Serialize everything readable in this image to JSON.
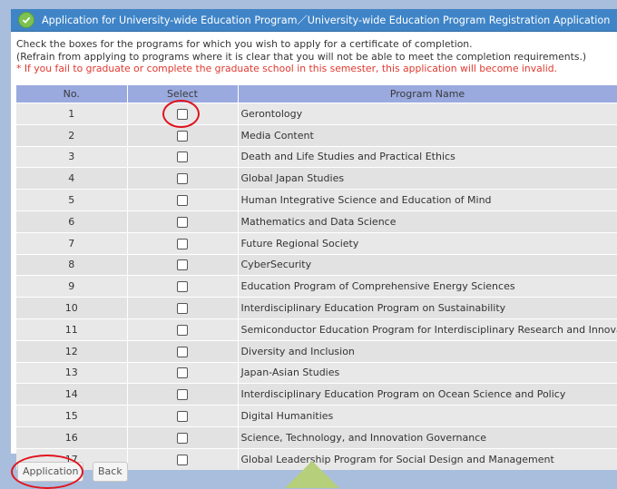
{
  "header": {
    "title": "Application for University-wide Education Program／University-wide Education Program Registration Application"
  },
  "instructions": {
    "line1": "Check the boxes for the programs for which you wish to apply for a certificate of completion.",
    "line2": "(Refrain from applying to programs where it is clear that you will not be able to meet the completion requirements.)",
    "warning": "* If you fail to graduate or complete the graduate school in this semester, this application will become invalid."
  },
  "table": {
    "headers": {
      "no": "No.",
      "select": "Select",
      "name": "Program Name"
    },
    "rows": [
      {
        "no": "1",
        "name": "Gerontology"
      },
      {
        "no": "2",
        "name": "Media Content"
      },
      {
        "no": "3",
        "name": "Death and Life Studies and Practical Ethics"
      },
      {
        "no": "4",
        "name": "Global Japan Studies"
      },
      {
        "no": "5",
        "name": "Human Integrative Science and Education of Mind"
      },
      {
        "no": "6",
        "name": "Mathematics and Data Science"
      },
      {
        "no": "7",
        "name": "Future Regional Society"
      },
      {
        "no": "8",
        "name": "CyberSecurity"
      },
      {
        "no": "9",
        "name": "Education Program of Comprehensive Energy Sciences"
      },
      {
        "no": "10",
        "name": "Interdisciplinary Education Program on Sustainability"
      },
      {
        "no": "11",
        "name": "Semiconductor Education Program for Interdisciplinary Research and Innovation"
      },
      {
        "no": "12",
        "name": "Diversity and Inclusion"
      },
      {
        "no": "13",
        "name": "Japan-Asian Studies"
      },
      {
        "no": "14",
        "name": "Interdisciplinary Education Program on Ocean Science and Policy"
      },
      {
        "no": "15",
        "name": "Digital Humanities"
      },
      {
        "no": "16",
        "name": "Science, Technology, and Innovation Governance"
      },
      {
        "no": "17",
        "name": "Global Leadership Program for Social Design and Management"
      }
    ]
  },
  "footer": {
    "application_label": "Application",
    "back_label": "Back"
  },
  "colors": {
    "title_bar": "#3f84c7",
    "header_row": "#9aa9de",
    "warning_text": "#e0382e",
    "highlight_circle": "#e0141e",
    "background": "#a9bddc"
  },
  "icons": [
    "check-icon",
    "up-arrow-icon"
  ]
}
